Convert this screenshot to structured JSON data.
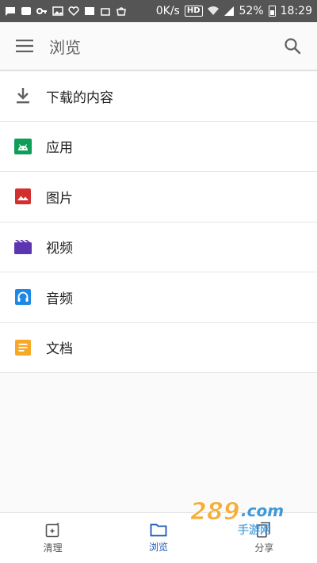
{
  "status_bar": {
    "speed": "0K/s",
    "hd": "HD",
    "battery": "52%",
    "time": "18:29"
  },
  "app_bar": {
    "title": "浏览"
  },
  "list": [
    {
      "label": "下载的内容",
      "icon": "download-icon",
      "color": "#616161"
    },
    {
      "label": "应用",
      "icon": "android-icon",
      "color": "#0f9d58"
    },
    {
      "label": "图片",
      "icon": "image-icon",
      "color": "#d32f2f"
    },
    {
      "label": "视频",
      "icon": "video-icon",
      "color": "#5e35b1"
    },
    {
      "label": "音频",
      "icon": "headphones-icon",
      "color": "#1e88e5"
    },
    {
      "label": "文档",
      "icon": "document-icon",
      "color": "#f9a825"
    }
  ],
  "bottom_nav": {
    "items": [
      {
        "label": "清理",
        "icon": "clean-icon"
      },
      {
        "label": "浏览",
        "icon": "folder-icon",
        "active": true
      },
      {
        "label": "分享",
        "icon": "share-icon"
      }
    ]
  },
  "watermark": {
    "text": "289.com",
    "subtext": "手游网"
  },
  "colors": {
    "accent": "#1a56b8",
    "status_bar": "#555555"
  }
}
